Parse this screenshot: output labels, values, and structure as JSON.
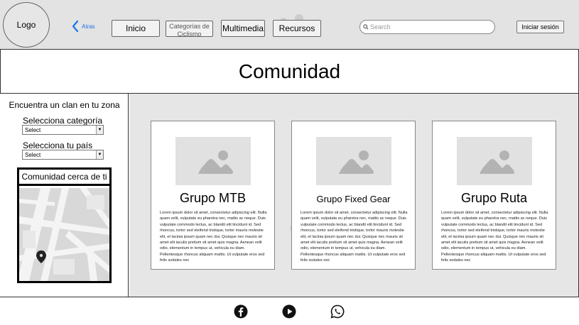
{
  "header": {
    "logo": "Logo",
    "back_label": "Atras",
    "nav": [
      {
        "label": "Inicio"
      },
      {
        "label": "Categorías de Ciclismo"
      },
      {
        "label": "Multimedia"
      },
      {
        "label": "Recursos"
      }
    ],
    "search_placeholder": "Search",
    "login_label": "Iniciar sesión"
  },
  "page": {
    "title": "Comunidad"
  },
  "sidebar": {
    "title": "Encuentra un clan en tu zona",
    "category_label": "Selecciona categoría",
    "category_value": "Select",
    "country_label": "Selecciona tu país",
    "country_value": "Select",
    "nearby_title": "Comunidad cerca de ti"
  },
  "groups": [
    {
      "name": "Grupo MTB",
      "text": "Lorem ipsum dolor sit amet, consectetur adipiscing elit. Nulla quam velit, vulputate eu pharetra nec, mattis ac neque. Duis vulputate commodo lectus, ac blandit elit tincidunt id. Sed rhoncus, tortor sed eleifend tristique, tortor mauris molestie elit, et lacinia ipsum quam nec dui. Quisque nec mauris sit amet elit iaculis pretium sit amet quis magna. Aenean velit odio, elementum in tempus ut, vehicula eu diam. Pellentesque rhoncus aliquam mattis. Ut vulputate eros sed felis sodales nec"
    },
    {
      "name": "Grupo Fixed Gear",
      "text": "Lorem ipsum dolor sit amet, consectetur adipiscing elit. Nulla quam velit, vulputate eu pharetra nec, mattis ac neque. Duis vulputate commodo lectus, ac blandit elit tincidunt id. Sed rhoncus, tortor sed eleifend tristique, tortor mauris molestie elit, et lacinia ipsum quam nec dui. Quisque nec mauris sit amet elit iaculis pretium sit amet quis magna. Aenean velit odio, elementum in tempus ut, vehicula eu diam. Pellentesque rhoncus aliquam mattis. Ut vulputate eros sed felis sodales nec"
    },
    {
      "name": "Grupo Ruta",
      "text": "Lorem ipsum dolor sit amet, consectetur adipiscing elit. Nulla quam velit, vulputate eu pharetra nec, mattis ac neque. Duis vulputate commodo lectus, ac blandit elit tincidunt id. Sed rhoncus, tortor sed eleifend tristique, tortor mauris molestie elit, et lacinia ipsum quam nec dui. Quisque nec mauris sit amet elit iaculis pretium sit amet quis magna. Aenean velit odio, elementum in tempus ut, vehicula eu diam. Pellentesque rhoncus aliquam mattis. Ut vulputate eros sed felis sodales nec"
    }
  ],
  "footer": {
    "icons": [
      "facebook-icon",
      "youtube-icon",
      "whatsapp-icon"
    ]
  },
  "colors": {
    "header_bg": "#e3e3e3",
    "main_bg": "#e6e6e6",
    "back_link": "#1a73e8",
    "placeholder_image": "#e1e1e1"
  }
}
